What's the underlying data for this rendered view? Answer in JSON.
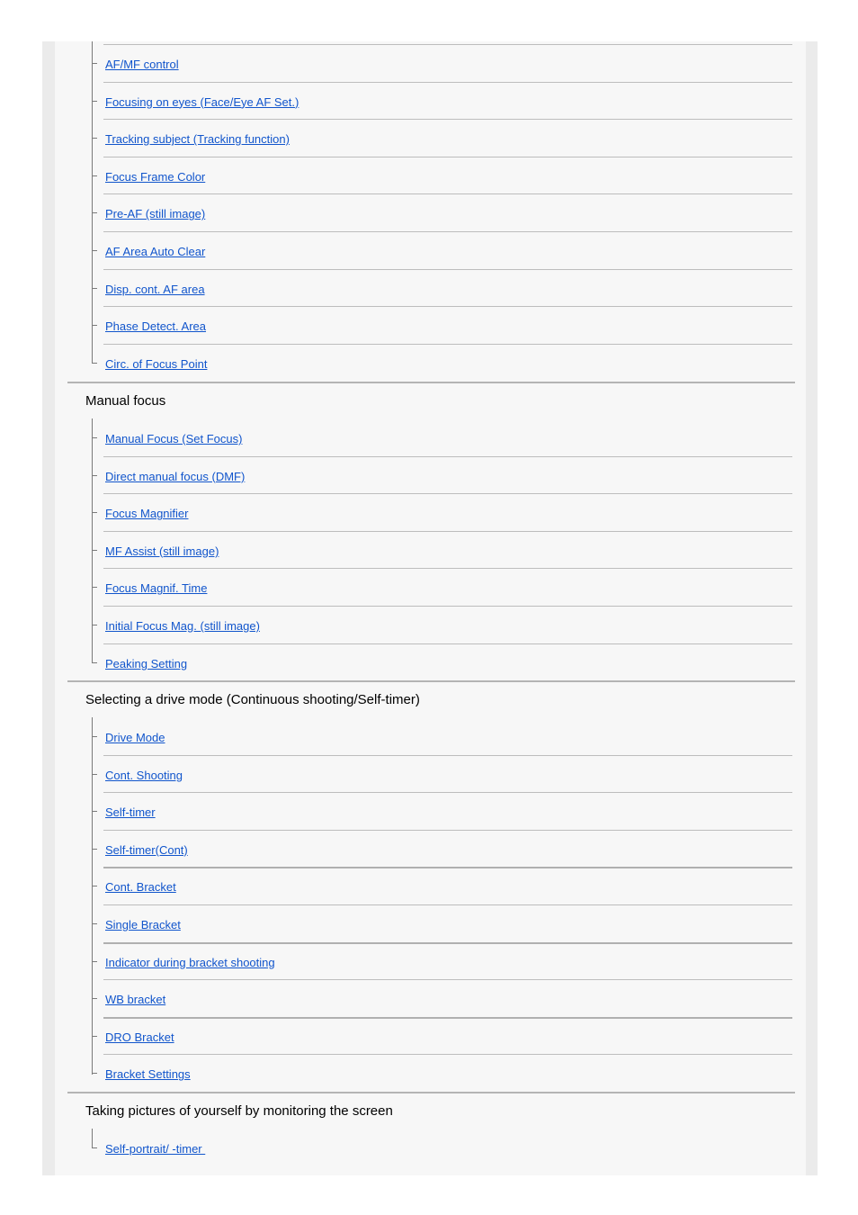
{
  "colors": {
    "link": "#1155cc",
    "panel_bg": "#f7f7f7",
    "separator": "#b4b4b4"
  },
  "groups": [
    {
      "title": "",
      "items": [
        {
          "label": "AF/MF control"
        },
        {
          "label": "Focusing on eyes (Face/Eye AF Set.)"
        },
        {
          "label": "Tracking subject (Tracking function)"
        },
        {
          "label": "Focus Frame Color"
        },
        {
          "label": "Pre-AF (still image)"
        },
        {
          "label": "AF Area Auto Clear"
        },
        {
          "label": "Disp. cont. AF area"
        },
        {
          "label": "Phase Detect. Area"
        },
        {
          "label": "Circ. of Focus Point"
        }
      ]
    },
    {
      "title": "Manual focus",
      "items": [
        {
          "label": "Manual Focus (Set Focus)"
        },
        {
          "label": "Direct manual focus (DMF)"
        },
        {
          "label": "Focus Magnifier"
        },
        {
          "label": "MF Assist (still image)"
        },
        {
          "label": "Focus Magnif. Time"
        },
        {
          "label": "Initial Focus Mag. (still image)"
        },
        {
          "label": "Peaking Setting"
        }
      ]
    },
    {
      "title": "Selecting a drive mode (Continuous shooting/Self-timer)",
      "items": [
        {
          "label": "Drive Mode"
        },
        {
          "label": "Cont. Shooting"
        },
        {
          "label": "Self-timer"
        },
        {
          "label": "Self-timer(Cont)"
        },
        {
          "label": "Cont. Bracket"
        },
        {
          "label": "Single Bracket"
        },
        {
          "label": "Indicator during bracket shooting"
        },
        {
          "label": "WB bracket"
        },
        {
          "label": "DRO Bracket"
        },
        {
          "label": "Bracket Settings"
        }
      ]
    },
    {
      "title": "Taking pictures of yourself by monitoring the screen",
      "items": [
        {
          "label": "Self-portrait/ -timer "
        }
      ]
    }
  ]
}
